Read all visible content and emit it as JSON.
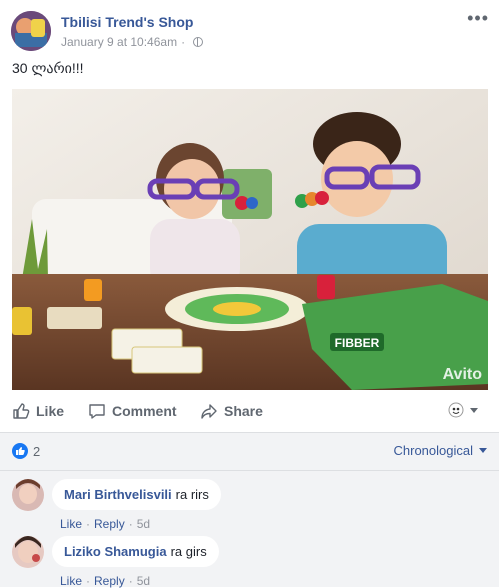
{
  "post": {
    "page_name": "Tbilisi Trend's Shop",
    "timestamp": "January 9 at 10:46am",
    "privacy_icon": "globe-icon",
    "more_icon": "more-horizontal-icon",
    "text": "30 ლარი!!!",
    "photo": {
      "box_brand": "FIBBER",
      "watermark": "Avito"
    }
  },
  "actions": {
    "like": "Like",
    "comment": "Comment",
    "share": "Share",
    "reaction_picker_icon": "reaction-avatar-icon"
  },
  "reactions": {
    "count": "2",
    "icon": "like-icon"
  },
  "sort": {
    "selected": "Chronological"
  },
  "comments": [
    {
      "author": "Mari Birthvelisvili",
      "text": "ra rirs",
      "like": "Like",
      "reply": "Reply",
      "age": "5d"
    },
    {
      "author": "Liziko Shamugia",
      "text": "ra girs",
      "like": "Like",
      "reply": "Reply",
      "age": "5d"
    }
  ],
  "colors": {
    "link": "#385898",
    "meta": "#90949c",
    "like_blue": "#1877f2",
    "comment_area": "#f2f3f5"
  }
}
